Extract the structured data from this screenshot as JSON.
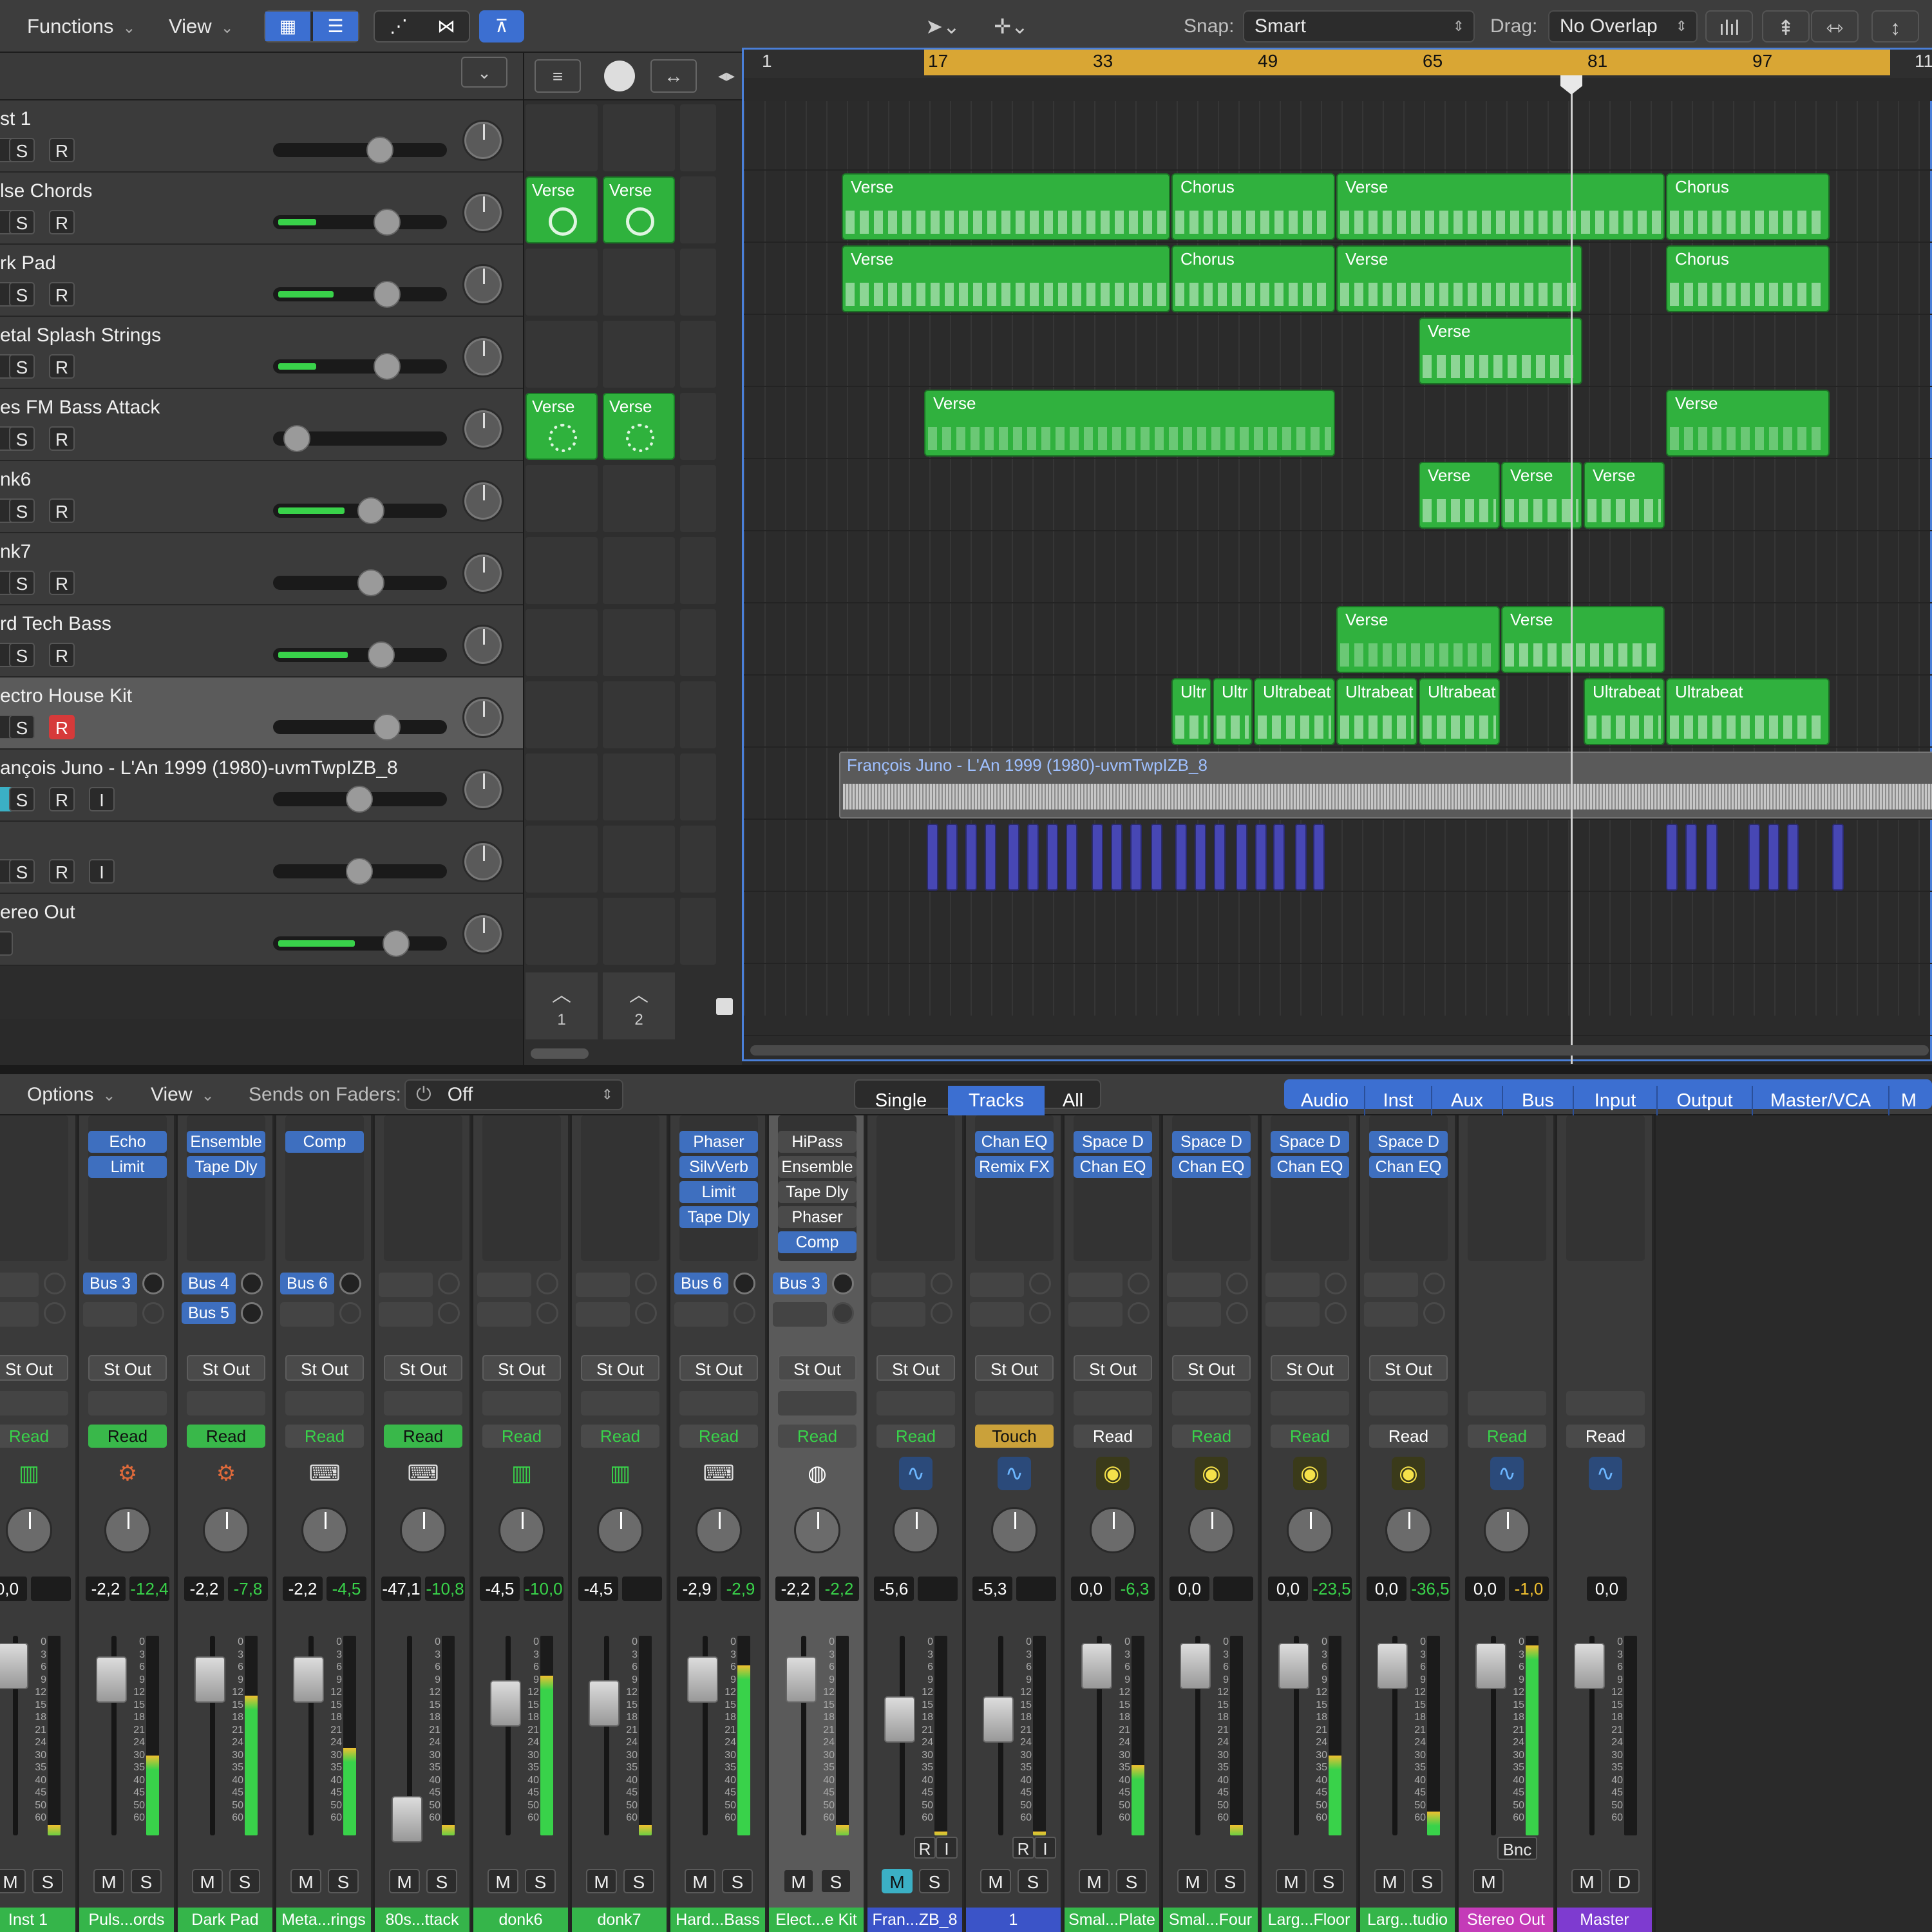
{
  "toolbar": {
    "functions": "Functions",
    "view": "View",
    "snap_label": "Snap:",
    "snap_value": "Smart",
    "drag_label": "Drag:",
    "drag_value": "No Overlap"
  },
  "ruler": {
    "bars": [
      "1",
      "17",
      "33",
      "49",
      "65",
      "81",
      "97",
      "11"
    ]
  },
  "tracks": [
    {
      "name": "st 1",
      "buttons": [
        "S",
        "R"
      ],
      "level": 0,
      "knob": 0.37
    },
    {
      "name": "lse Chords",
      "buttons": [
        "S",
        "R"
      ],
      "level": 0.22,
      "knob": 0.32
    },
    {
      "name": "rk Pad",
      "buttons": [
        "S",
        "R"
      ],
      "level": 0.32,
      "knob": 0.32
    },
    {
      "name": "etal Splash Strings",
      "buttons": [
        "S",
        "R"
      ],
      "level": 0.22,
      "knob": 0.32
    },
    {
      "name": "es FM Bass Attack",
      "buttons": [
        "S",
        "R"
      ],
      "level": 0,
      "knob": 0.93
    },
    {
      "name": "nk6",
      "buttons": [
        "S",
        "R"
      ],
      "level": 0.38,
      "knob": 0.43
    },
    {
      "name": "nk7",
      "buttons": [
        "S",
        "R"
      ],
      "level": 0,
      "knob": 0.43
    },
    {
      "name": "rd Tech Bass",
      "buttons": [
        "S",
        "R"
      ],
      "level": 0.4,
      "knob": 0.36
    },
    {
      "name": "ectro House Kit",
      "buttons": [
        "S",
        "R"
      ],
      "level": 0,
      "knob": 0.32
    },
    {
      "name": "ançois Juno - L'An 1999 (1980)-uvmTwpIZB_8",
      "buttons": [
        "S",
        "R",
        "I"
      ],
      "level": 0,
      "knob": 0.51
    },
    {
      "name": "",
      "buttons": [
        "S",
        "R",
        "I"
      ],
      "level": 0,
      "knob": 0.51
    },
    {
      "name": "ereo Out",
      "buttons": [],
      "level": 0.44,
      "knob": 0.26
    }
  ],
  "live_loops": {
    "clip_label": "Verse",
    "scenes": [
      "1",
      "2"
    ]
  },
  "region_labels": {
    "verse": "Verse",
    "chorus": "Chorus",
    "ultrabeat": "Ultrabeat",
    "ultr": "Ultr"
  },
  "audio_region": "François Juno - L'An 1999 (1980)-uvmTwpIZB_8",
  "mixer_bar": {
    "options": "Options",
    "view": "View",
    "sends_label": "Sends on Faders:",
    "sends_value": "Off",
    "modes": [
      "Single",
      "Tracks",
      "All"
    ],
    "filters": [
      "Audio",
      "Inst",
      "Aux",
      "Bus",
      "Input",
      "Output",
      "Master/VCA",
      "M"
    ]
  },
  "meter_scale": [
    "0",
    "3",
    "6",
    "9",
    "12",
    "15",
    "18",
    "21",
    "24",
    "30",
    "35",
    "40",
    "45",
    "50",
    "60"
  ],
  "strips": [
    {
      "name": "Inst 1",
      "plugins": [],
      "sends": [],
      "output": "St Out",
      "auto": "Read",
      "icon": "inst",
      "vol": "0,0",
      "peak": "",
      "fader": 0.15,
      "meter": 0.05,
      "mute_on": false
    },
    {
      "name": "Puls...ords",
      "plugins": [
        "Echo",
        "Limit"
      ],
      "sends": [
        "Bus 3"
      ],
      "output": "St Out",
      "auto": "Read",
      "icon": "synth",
      "vol": "-2,2",
      "peak": "-12,4",
      "fader": 0.22,
      "meter": 0.4,
      "mute_on": false
    },
    {
      "name": "Dark Pad",
      "plugins": [
        "Ensemble",
        "Tape Dly"
      ],
      "sends": [
        "Bus 4",
        "Bus 5"
      ],
      "output": "St Out",
      "auto": "Read",
      "icon": "synth",
      "vol": "-2,2",
      "peak": "-7,8",
      "fader": 0.22,
      "meter": 0.7,
      "mute_on": false
    },
    {
      "name": "Meta...rings",
      "plugins": [
        "Comp"
      ],
      "sends": [
        "Bus 6"
      ],
      "output": "St Out",
      "auto": "Read",
      "icon": "key",
      "vol": "-2,2",
      "peak": "-4,5",
      "fader": 0.22,
      "meter": 0.44,
      "mute_on": false
    },
    {
      "name": "80s...ttack",
      "plugins": [],
      "sends": [],
      "output": "St Out",
      "auto": "Read",
      "icon": "key",
      "vol": "-47,1",
      "peak": "-10,8",
      "fader": 0.92,
      "meter": 0.05,
      "mute_on": false
    },
    {
      "name": "donk6",
      "plugins": [],
      "sends": [],
      "output": "St Out",
      "auto": "Read",
      "icon": "inst",
      "vol": "-4,5",
      "peak": "-10,0",
      "fader": 0.34,
      "meter": 0.8,
      "mute_on": false
    },
    {
      "name": "donk7",
      "plugins": [],
      "sends": [],
      "output": "St Out",
      "auto": "Read",
      "icon": "inst",
      "vol": "-4,5",
      "peak": "",
      "fader": 0.34,
      "meter": 0.05,
      "mute_on": false
    },
    {
      "name": "Hard...Bass",
      "plugins": [
        "Phaser",
        "SilvVerb",
        "Limit",
        "Tape Dly"
      ],
      "sends": [
        "Bus 6"
      ],
      "output": "St Out",
      "auto": "Read",
      "icon": "key",
      "vol": "-2,9",
      "peak": "-2,9",
      "fader": 0.22,
      "meter": 0.85,
      "mute_on": false
    },
    {
      "name": "Elect...e Kit",
      "plugins": [
        "HiPass",
        "Ensemble",
        "Tape Dly",
        "Phaser",
        "Comp"
      ],
      "sends": [
        "Bus 3"
      ],
      "output": "St Out",
      "auto": "Read",
      "icon": "drum",
      "vol": "-2,2",
      "peak": "-2,2",
      "fader": 0.22,
      "meter": 0.05,
      "mute_on": false
    },
    {
      "name": "Fran...ZB_8",
      "plugins": [],
      "sends": [],
      "output": "St Out",
      "auto": "Read",
      "icon": "aud",
      "vol": "-5,6",
      "peak": "",
      "fader": 0.42,
      "meter": 0.02,
      "mute_on": true
    },
    {
      "name": "1",
      "plugins": [
        "Chan EQ",
        "Remix FX"
      ],
      "sends": [],
      "output": "St Out",
      "auto": "Touch",
      "icon": "aud",
      "vol": "-5,3",
      "peak": "",
      "fader": 0.42,
      "meter": 0.02,
      "mute_on": false
    },
    {
      "name": "Smal...Plate",
      "plugins": [
        "Space D",
        "Chan EQ"
      ],
      "sends": [],
      "output": "St Out",
      "auto": "Read",
      "icon": "knobicon",
      "vol": "0,0",
      "peak": "-6,3",
      "fader": 0.15,
      "meter": 0.35,
      "mute_on": false
    },
    {
      "name": "Smal...Four",
      "plugins": [
        "Space D",
        "Chan EQ"
      ],
      "sends": [],
      "output": "St Out",
      "auto": "Read",
      "icon": "knobicon",
      "vol": "0,0",
      "peak": "",
      "fader": 0.15,
      "meter": 0.05,
      "mute_on": false
    },
    {
      "name": "Larg...Floor",
      "plugins": [
        "Space D",
        "Chan EQ"
      ],
      "sends": [],
      "output": "St Out",
      "auto": "Read",
      "icon": "knobicon",
      "vol": "0,0",
      "peak": "-23,5",
      "fader": 0.15,
      "meter": 0.4,
      "mute_on": false
    },
    {
      "name": "Larg...tudio",
      "plugins": [
        "Space D",
        "Chan EQ"
      ],
      "sends": [],
      "output": "St Out",
      "auto": "Read",
      "icon": "knobicon",
      "vol": "0,0",
      "peak": "-36,5",
      "fader": 0.15,
      "meter": 0.12,
      "mute_on": false
    },
    {
      "name": "Stereo Out",
      "plugins": [],
      "sends": [],
      "output": "",
      "auto": "Read",
      "icon": "aud",
      "vol": "0,0",
      "peak": "-1,0",
      "fader": 0.15,
      "meter": 0.95,
      "mute_on": false
    },
    {
      "name": "Master",
      "plugins": [],
      "sends": [],
      "output": "",
      "auto": "Read",
      "icon": "aud",
      "vol": "0,0",
      "peak": "",
      "fader": 0.15,
      "meter": 0,
      "mute_on": false
    }
  ],
  "strip_name_colors": [
    "#35b54a",
    "#35b54a",
    "#35b54a",
    "#35b54a",
    "#35b54a",
    "#35b54a",
    "#35b54a",
    "#35b54a",
    "#35b54a",
    "#3b54c8",
    "#3b54c8",
    "#35b54a",
    "#35b54a",
    "#35b54a",
    "#35b54a",
    "#c43bb8",
    "#7e3bd0"
  ],
  "bnc_label": "Bnc",
  "master_d": "D"
}
